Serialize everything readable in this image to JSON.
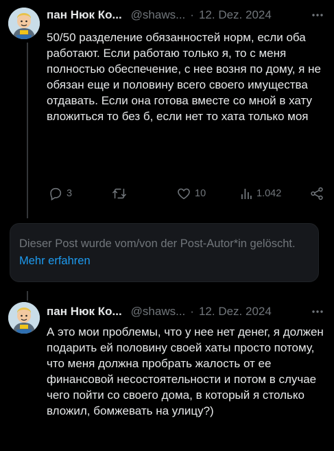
{
  "tweet1": {
    "name": "пан Нюк Ко...",
    "handle": "@shaws...",
    "separator": "·",
    "date": "12. Dez. 2024",
    "text": "50/50 разделение обязанностей норм, если оба работают. Если работаю только я, то с меня полностью обеспечение, с нее возня по дому, я не обязан еще и половину всего своего имущества отдавать. Если она готова вместе со мной в хату вложиться то без б, если нет то хата только моя",
    "actions": {
      "reply_count": "3",
      "retweet_count": "",
      "like_count": "10",
      "view_count": "1.042"
    }
  },
  "deleted_post": {
    "text": "Dieser Post wurde vom/von der Post-Autor*in gelöscht.",
    "link": "Mehr erfahren"
  },
  "tweet2": {
    "name": "пан Нюк Ко...",
    "handle": "@shaws...",
    "separator": "·",
    "date": "12. Dez. 2024",
    "text": "А это мои проблемы, что у нее нет денег, я должен подарить ей половину своей хаты просто потому, что меня должна пробрать жалость от ее финансовой несостоятельности и потом в случае чего пойти со своего дома, в который я столько вложил, бомжевать на улицу?)"
  },
  "icons": {
    "more": "more-dots-icon",
    "reply": "reply-bubble-icon",
    "retweet": "retweet-icon",
    "like": "heart-icon",
    "views": "views-bars-icon",
    "share": "share-icon"
  }
}
